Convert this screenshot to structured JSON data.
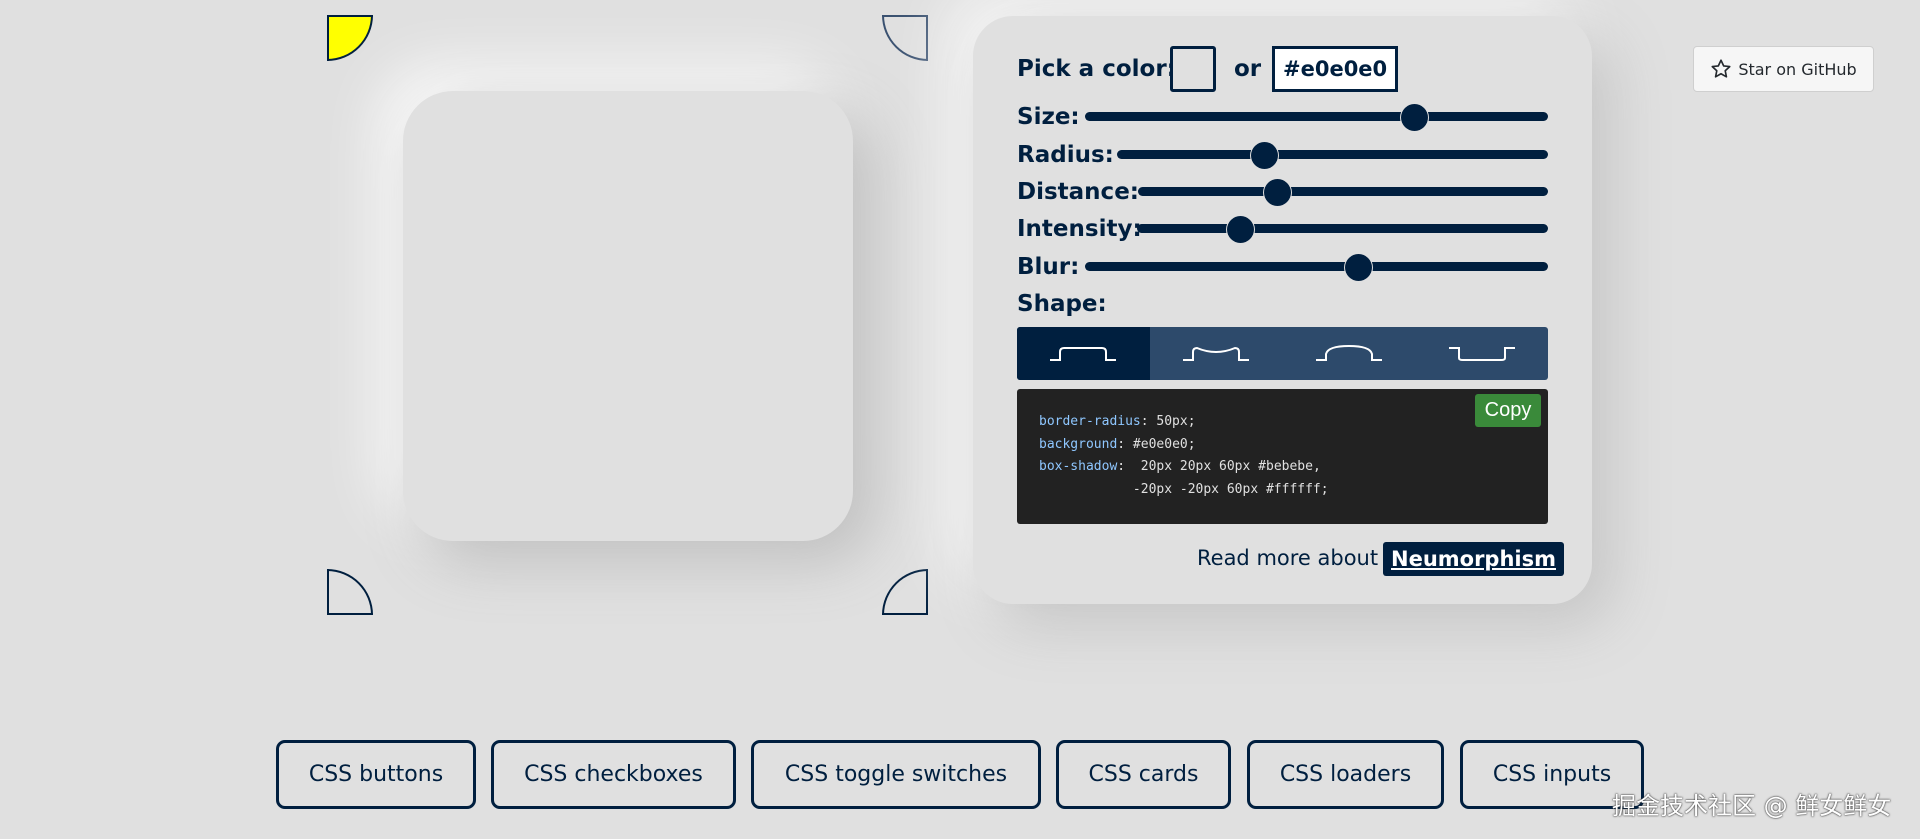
{
  "colors": {
    "background": "#e0e0e0",
    "primary": "#001f3f",
    "light_active": "#ffff00",
    "copy_button": "#3a8a3a"
  },
  "light_sources": {
    "active": "top-left"
  },
  "controls": {
    "pick_color_label": "Pick a color:",
    "or_label": "or",
    "hex_value": "#e0e0e0",
    "sliders": [
      {
        "label": "Size:",
        "value": 0.71
      },
      {
        "label": "Radius:",
        "value": 0.34
      },
      {
        "label": "Distance:",
        "value": 0.34
      },
      {
        "label": "Intensity:",
        "value": 0.25
      },
      {
        "label": "Blur:",
        "value": 0.59
      }
    ],
    "shape_label": "Shape:",
    "shapes": [
      {
        "name": "flat",
        "active": true
      },
      {
        "name": "concave",
        "active": false
      },
      {
        "name": "convex",
        "active": false
      },
      {
        "name": "pressed",
        "active": false
      }
    ]
  },
  "code": {
    "lines": [
      {
        "prop": "border-radius",
        "value": ": 50px;"
      },
      {
        "prop": "background",
        "value": ": #e0e0e0;"
      },
      {
        "prop": "box-shadow",
        "value": ":  20px 20px 60px #bebebe,"
      },
      {
        "prop": "",
        "value": "            -20px -20px 60px #ffffff;"
      }
    ],
    "copy_label": "Copy"
  },
  "read_more": {
    "text": "Read more about",
    "link_label": "Neumorphism"
  },
  "github": {
    "label": "Star on GitHub",
    "icon": "star-icon"
  },
  "nav": [
    {
      "label": "CSS buttons"
    },
    {
      "label": "CSS checkboxes"
    },
    {
      "label": "CSS toggle switches"
    },
    {
      "label": "CSS cards"
    },
    {
      "label": "CSS loaders"
    },
    {
      "label": "CSS inputs"
    }
  ],
  "watermark": "掘金技术社区 @ 鲜女鲜女"
}
